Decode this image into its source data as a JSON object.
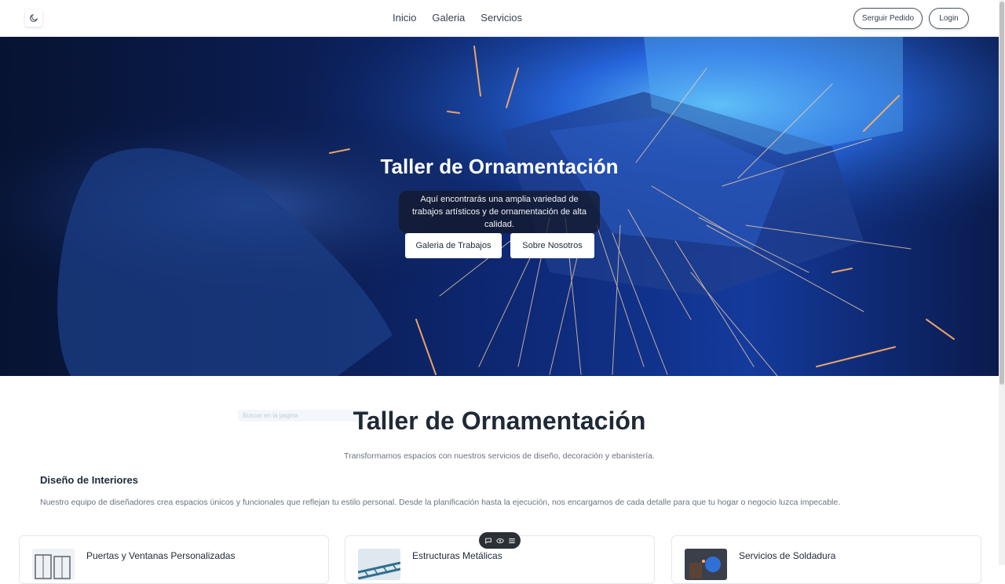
{
  "header": {
    "nav": [
      "Inicio",
      "Galeria",
      "Servicios"
    ],
    "track_button": "Serguir Pedido",
    "login_button": "Login"
  },
  "hero": {
    "title": "Taller de Ornamentación",
    "subtitle": "Aquí encontrarás una amplia variedad de trabajos artísticos y de ornamentación de alta calidad.",
    "gallery_button": "Galeria de Trabajos",
    "about_button": "Sobre Nosotros"
  },
  "intro": {
    "title": "Taller de Ornamentación",
    "subtitle": "Transformamos espacios con nuestros servicios de diseño, decoración y ebanistería.",
    "faint_search": "Buscar en la pagina"
  },
  "design_block": {
    "title": "Diseño de Interiores",
    "text": "Nuestro equipo de diseñadores crea espacios únicos y funcionales que reflejan tu estilo personal. Desde la planificación hasta la ejecución, nos encargamos de cada detalle para que tu hogar o negocio luzca impecable."
  },
  "cards": [
    {
      "title": "Puertas y Ventanas Personalizadas"
    },
    {
      "title": "Estructuras Metálicas"
    },
    {
      "title": "Servicios de Soldadura"
    }
  ],
  "icons": {
    "theme": "moon-icon",
    "toolbar": [
      "chat-icon",
      "eye-icon",
      "menu-icon"
    ]
  },
  "colors": {
    "hero_dark": "#0b1d52",
    "hero_blue": "#143a9c",
    "spark": "#ffb066",
    "text_dark": "#1f2937",
    "text_muted": "#6b7280"
  }
}
